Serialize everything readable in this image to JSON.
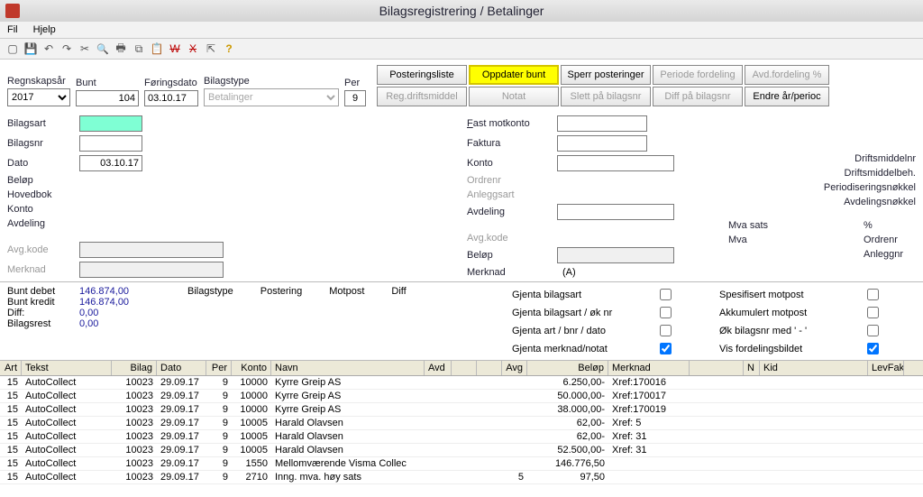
{
  "titlebar": {
    "title": "Bilagsregistrering / Betalinger"
  },
  "menu": {
    "fil": "Fil",
    "hjelp": "Hjelp"
  },
  "toolbar_icons": [
    "new",
    "save",
    "undo",
    "redo",
    "cut",
    "find",
    "print",
    "copy",
    "paste",
    "delW",
    "delX",
    "export",
    "help"
  ],
  "top": {
    "regnskapsar_lbl": "Regnskapsår",
    "regnskapsar": "2017",
    "bunt_lbl": "Bunt",
    "bunt": "104",
    "foringsdato_lbl": "Føringsdato",
    "foringsdato": "03.10.17",
    "bilagstype_lbl": "Bilagstype",
    "bilagstype": "Betalinger",
    "per_lbl": "Per",
    "per": "9"
  },
  "buttons": {
    "posteringsliste": "Posteringsliste",
    "oppdater_bunt": "Oppdater bunt",
    "sperr_posteringer": "Sperr posteringer",
    "periode_fordeling": "Periode fordeling",
    "avd_fordeling": "Avd.fordeling %",
    "reg_driftsmiddel": "Reg.driftsmiddel",
    "notat": "Notat",
    "slett_pa_bilagsnr": "Slett på bilagsnr",
    "diff_pa_bilagsnr": "Diff på bilagsnr",
    "endre_ar": "Endre år/perioc"
  },
  "left": {
    "bilagsart": "Bilagsart",
    "bilagsart_v": "",
    "bilagsnr": "Bilagsnr",
    "bilagsnr_v": "",
    "dato": "Dato",
    "dato_v": "03.10.17",
    "belop": "Beløp",
    "belop_v": "",
    "hovedbok": "Hovedbok",
    "hovedbok_v": "",
    "konto": "Konto",
    "konto_v": "",
    "avdeling": "Avdeling",
    "avdeling_v": "",
    "avgkode": "Avg.kode",
    "avgkode_v": "",
    "merknad": "Merknad",
    "merknad_v": ""
  },
  "mid": {
    "fast_motkonto": "Fast motkonto",
    "fast_motkonto_v": "",
    "faktura": "Faktura",
    "faktura_v": "",
    "konto": "Konto",
    "konto_v": "",
    "ordrenr": "Ordrenr",
    "anleggsart": "Anleggsart",
    "avdeling": "Avdeling",
    "avdeling_v": "",
    "avgkode": "Avg.kode",
    "belop": "Beløp",
    "belop_v": "",
    "merknad": "Merknad",
    "merknad_a": "(A)"
  },
  "right": {
    "driftsmiddelnr": "Driftsmiddelnr",
    "driftsmiddelbeh": "Driftsmiddelbeh.",
    "periodiseringsnokkel": "Periodiseringsnøkkel",
    "avdelingsnokkel": "Avdelingsnøkkel",
    "mvasats": "Mva sats",
    "pct": "%",
    "mva": "Mva",
    "ordrenr": "Ordrenr",
    "anleggnr": "Anleggnr"
  },
  "sums": {
    "bunt_debet_l": "Bunt debet",
    "bunt_debet": "146.874,00",
    "bunt_kredit_l": "Bunt kredit",
    "bunt_kredit": "146.874,00",
    "diff_l": "Diff:",
    "diff": "0,00",
    "bilagsrest_l": "Bilagsrest",
    "bilagsrest": "0,00",
    "bilagstype_l": "Bilagstype",
    "postering_l": "Postering",
    "motpost_l": "Motpost",
    "diffh_l": "Diff",
    "gjenta_bilagsart": "Gjenta bilagsart",
    "gjenta_bilagsart_ok": "Gjenta bilagsart / øk nr",
    "gjenta_art_bnr": "Gjenta art / bnr / dato",
    "gjenta_merknad": "Gjenta merknad/notat",
    "spes_motpost": "Spesifisert motpost",
    "akk_motpost": "Akkumulert motpost",
    "ok_bilagsnr": "Øk bilagsnr med ' - '",
    "vis_fordeling": "Vis fordelingsbildet"
  },
  "table": {
    "headers": {
      "art": "Art",
      "tekst": "Tekst",
      "bilag": "Bilag",
      "dato": "Dato",
      "per": "Per",
      "konto": "Konto",
      "navn": "Navn",
      "avd": "Avd",
      "avg": "Avg",
      "belop": "Beløp",
      "merknad": "Merknad",
      "n": "N",
      "kid": "Kid",
      "levfak": "LevFak"
    },
    "rows": [
      {
        "art": "15",
        "tekst": "AutoCollect",
        "bilag": "10023",
        "dato": "29.09.17",
        "per": "9",
        "konto": "10000",
        "navn": "Kyrre Greip AS",
        "avd": "",
        "avg": "",
        "belop": "6.250,00-",
        "merknad": "Xref:170016"
      },
      {
        "art": "15",
        "tekst": "AutoCollect",
        "bilag": "10023",
        "dato": "29.09.17",
        "per": "9",
        "konto": "10000",
        "navn": "Kyrre Greip AS",
        "avd": "",
        "avg": "",
        "belop": "50.000,00-",
        "merknad": "Xref:170017"
      },
      {
        "art": "15",
        "tekst": "AutoCollect",
        "bilag": "10023",
        "dato": "29.09.17",
        "per": "9",
        "konto": "10000",
        "navn": "Kyrre Greip AS",
        "avd": "",
        "avg": "",
        "belop": "38.000,00-",
        "merknad": "Xref:170019"
      },
      {
        "art": "15",
        "tekst": "AutoCollect",
        "bilag": "10023",
        "dato": "29.09.17",
        "per": "9",
        "konto": "10005",
        "navn": "Harald Olavsen",
        "avd": "",
        "avg": "",
        "belop": "62,00-",
        "merknad": "Xref:     5"
      },
      {
        "art": "15",
        "tekst": "AutoCollect",
        "bilag": "10023",
        "dato": "29.09.17",
        "per": "9",
        "konto": "10005",
        "navn": "Harald Olavsen",
        "avd": "",
        "avg": "",
        "belop": "62,00-",
        "merknad": "Xref:   31"
      },
      {
        "art": "15",
        "tekst": "AutoCollect",
        "bilag": "10023",
        "dato": "29.09.17",
        "per": "9",
        "konto": "10005",
        "navn": "Harald Olavsen",
        "avd": "",
        "avg": "",
        "belop": "52.500,00-",
        "merknad": "Xref:   31"
      },
      {
        "art": "15",
        "tekst": "AutoCollect",
        "bilag": "10023",
        "dato": "29.09.17",
        "per": "9",
        "konto": "1550",
        "navn": "Mellomværende Visma Collec",
        "avd": "",
        "avg": "",
        "belop": "146.776,50",
        "merknad": ""
      },
      {
        "art": "15",
        "tekst": "AutoCollect",
        "bilag": "10023",
        "dato": "29.09.17",
        "per": "9",
        "konto": "2710",
        "navn": "Inng. mva. høy sats",
        "avd": "",
        "avg": "5",
        "belop": "97,50",
        "merknad": ""
      }
    ]
  }
}
